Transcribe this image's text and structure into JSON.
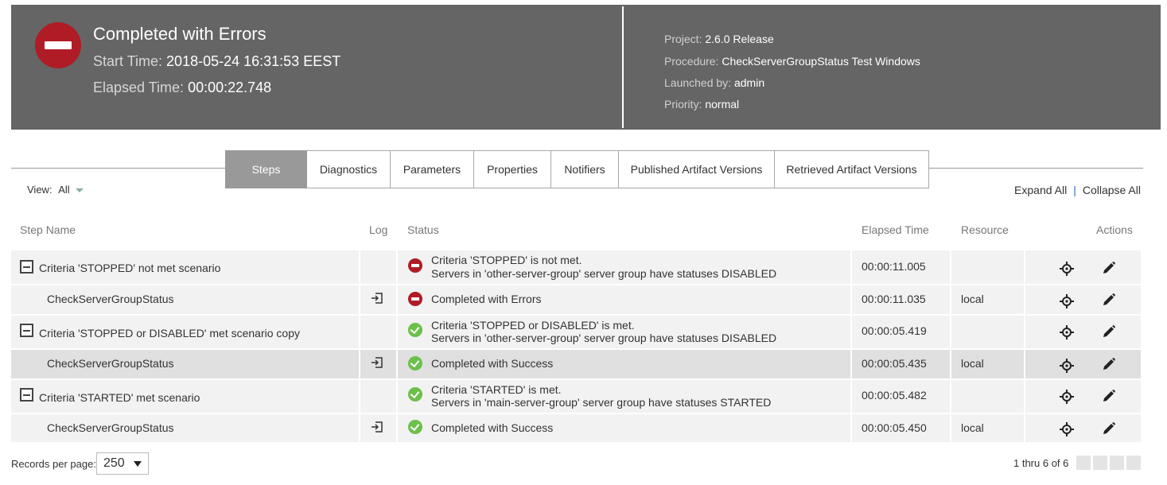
{
  "header": {
    "title": "Completed with Errors",
    "start_label": "Start Time:",
    "start_value": "2018-05-24 16:31:53 EEST",
    "elapsed_label": "Elapsed Time:",
    "elapsed_value": "00:00:22.748",
    "project_label": "Project:",
    "project_value": "2.6.0 Release",
    "procedure_label": "Procedure:",
    "procedure_value": "CheckServerGroupStatus Test Windows",
    "launched_label": "Launched by:",
    "launched_value": "admin",
    "priority_label": "Priority:",
    "priority_value": "normal",
    "status_color": "#b01c25"
  },
  "tabs": [
    {
      "label": "Steps",
      "active": true
    },
    {
      "label": "Diagnostics"
    },
    {
      "label": "Parameters"
    },
    {
      "label": "Properties"
    },
    {
      "label": "Notifiers"
    },
    {
      "label": "Published Artifact Versions"
    },
    {
      "label": "Retrieved Artifact Versions"
    }
  ],
  "view": {
    "label": "View:",
    "value": "All"
  },
  "expand_all": "Expand All",
  "collapse_all": "Collapse All",
  "columns": {
    "step_name": "Step Name",
    "log": "Log",
    "status": "Status",
    "elapsed": "Elapsed Time",
    "resource": "Resource",
    "actions": "Actions"
  },
  "rows": [
    {
      "name": "Criteria 'STOPPED' not met scenario",
      "status1": "Criteria 'STOPPED' is not met.",
      "status2": "Servers in 'other-server-group' server group have statuses DISABLED",
      "elapsed": "00:00:11.005",
      "resource": ""
    },
    {
      "name": "CheckServerGroupStatus",
      "status1": "Completed with Errors",
      "status2": "",
      "elapsed": "00:00:11.035",
      "resource": "local"
    },
    {
      "name": "Criteria 'STOPPED or DISABLED' met scenario copy",
      "status1": "Criteria 'STOPPED or DISABLED' is met.",
      "status2": "Servers in 'other-server-group' server group have statuses DISABLED",
      "elapsed": "00:00:05.419",
      "resource": ""
    },
    {
      "name": "CheckServerGroupStatus",
      "status1": "Completed with Success",
      "status2": "",
      "elapsed": "00:00:05.435",
      "resource": "local"
    },
    {
      "name": "Criteria 'STARTED' met scenario",
      "status1": "Criteria 'STARTED' is met.",
      "status2": "Servers in 'main-server-group' server group have statuses STARTED",
      "elapsed": "00:00:05.482",
      "resource": ""
    },
    {
      "name": "CheckServerGroupStatus",
      "status1": "Completed with Success",
      "status2": "",
      "elapsed": "00:00:05.450",
      "resource": "local"
    }
  ],
  "footer": {
    "records_label": "Records per page:",
    "records_value": "250",
    "page_info": "1 thru 6 of 6"
  }
}
